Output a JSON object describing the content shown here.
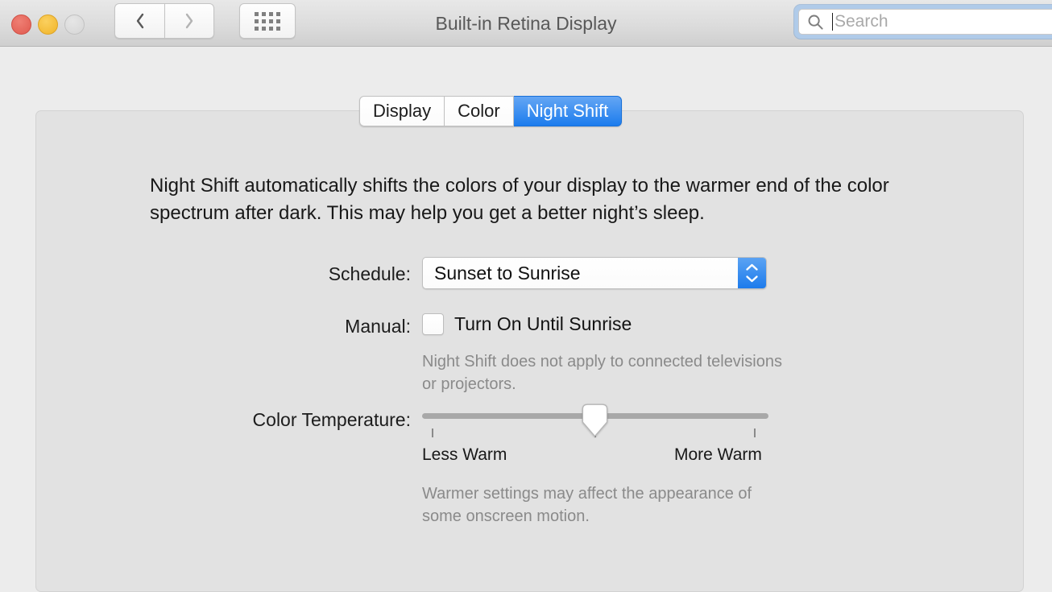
{
  "window": {
    "title": "Built-in Retina Display",
    "traffic_lights": [
      {
        "name": "close",
        "color": "#e05a4f"
      },
      {
        "name": "minimize",
        "color": "#f0b429"
      },
      {
        "name": "zoom",
        "color": "#d5d5d5"
      }
    ],
    "toolbar": {
      "back_icon": "chevron-left-icon",
      "forward_icon": "chevron-right-icon",
      "show_all_icon": "grid-icon"
    },
    "search": {
      "icon": "search-icon",
      "value": "",
      "placeholder": "Search",
      "focused": true,
      "focus_ring_color": "#b0cbe9"
    }
  },
  "tabs": [
    {
      "label": "Display",
      "selected": false
    },
    {
      "label": "Color",
      "selected": false
    },
    {
      "label": "Night Shift",
      "selected": true
    }
  ],
  "accent_color": "#1c7ced",
  "panel": {
    "description": "Night Shift automatically shifts the colors of your display to the warmer end of the color spectrum after dark. This may help you get a better night’s sleep.",
    "schedule": {
      "label": "Schedule:",
      "value": "Sunset to Sunrise",
      "stepper_icon": "chevron-up-down-icon"
    },
    "manual": {
      "label": "Manual:",
      "checkbox_label": "Turn On Until Sunrise",
      "checked": false,
      "note": "Night Shift does not apply to connected televisions or projectors."
    },
    "color_temperature": {
      "label": "Color Temperature:",
      "min_label": "Less Warm",
      "max_label": "More Warm",
      "value_percent": 50,
      "tick_percents": [
        3,
        50,
        96
      ],
      "note": "Warmer settings may affect the appearance of some onscreen motion."
    }
  }
}
